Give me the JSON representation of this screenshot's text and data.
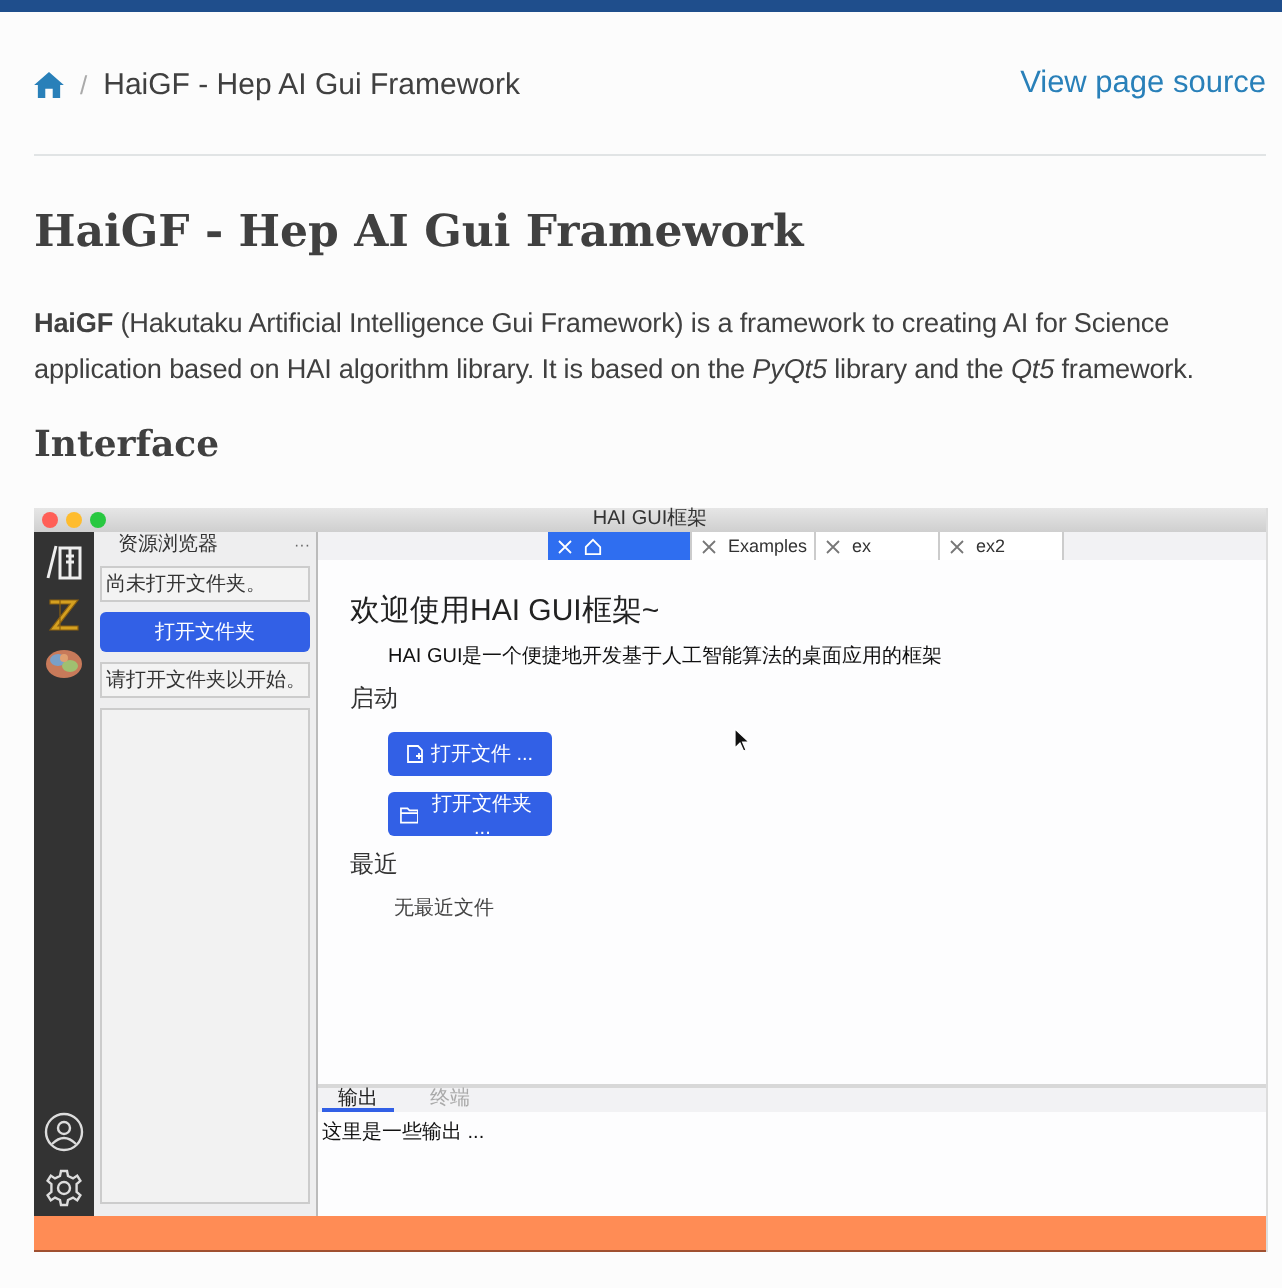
{
  "breadcrumb": {
    "separator": "/",
    "current": "HaiGF - Hep AI Gui Framework",
    "source_link": "View page source"
  },
  "title": "HaiGF - Hep AI Gui Framework",
  "intro": "**HaiGF** (Hakutaku Artificial Intelligence Gui Framework) is a framework to creating AI for Science application based on HAI algorithm library. It is based on the *PyQt5* library and the *Qt5* framework.",
  "section_heading": "Interface",
  "app": {
    "window_title": "HAI GUI框架",
    "explorer": {
      "title": "资源浏览器",
      "more": "···",
      "status": "尚未打开文件夹。",
      "button": "打开文件夹",
      "hint": "请打开文件夹以开始。"
    },
    "tabs": [
      {
        "kind": "home",
        "selected": true
      },
      {
        "kind": "text",
        "label": "Examples",
        "selected": false
      },
      {
        "kind": "text",
        "label": "ex",
        "selected": false
      },
      {
        "kind": "text",
        "label": "ex2",
        "selected": false
      }
    ],
    "welcome": {
      "title": "欢迎使用HAI GUI框架~",
      "subtitle": "HAI GUI是一个便捷地开发基于人工智能算法的桌面应用的框架",
      "start_heading": "启动",
      "actions": [
        {
          "kind": "file",
          "label": "打开文件 ..."
        },
        {
          "kind": "folder",
          "label": "打开文件夹 ..."
        }
      ],
      "recent_heading": "最近",
      "recent_empty": "无最近文件"
    },
    "panel_tabs": [
      {
        "label": "输出",
        "selected": true
      },
      {
        "label": "终端",
        "selected": false
      }
    ],
    "output": "这里是一些输出 ..."
  }
}
